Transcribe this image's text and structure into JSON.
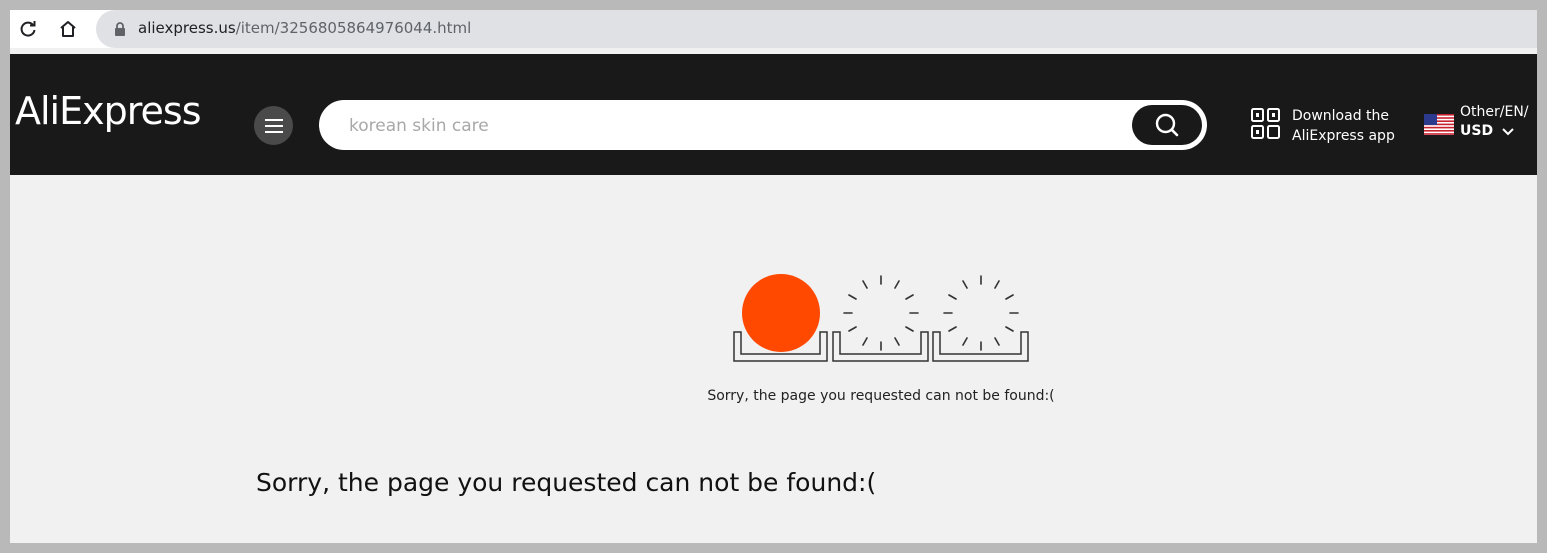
{
  "browser": {
    "url_host": "aliexpress.us",
    "url_path": "/item/3256805864976044.html"
  },
  "header": {
    "logo": "AliExpress",
    "search_placeholder": "korean skin care",
    "app_download_line1": "Download the",
    "app_download_line2": "AliExpress app",
    "locale_line1": "Other/EN/",
    "locale_currency": "USD"
  },
  "main": {
    "illustration_digits": [
      "0",
      "0",
      "0"
    ],
    "error_message_small": "Sorry, the page you requested can not be found:(",
    "error_message_large": "Sorry, the page you requested can not be found:("
  },
  "colors": {
    "header_bg": "#191919",
    "page_bg": "#f1f1f1",
    "accent_orange": "#ff4800"
  },
  "icons": {
    "reload": "reload-icon",
    "home": "home-icon",
    "lock": "lock-icon",
    "menu": "hamburger-icon",
    "search": "search-icon",
    "qr": "qr-code-icon",
    "flag": "us-flag-icon",
    "chevron": "chevron-down-icon"
  }
}
